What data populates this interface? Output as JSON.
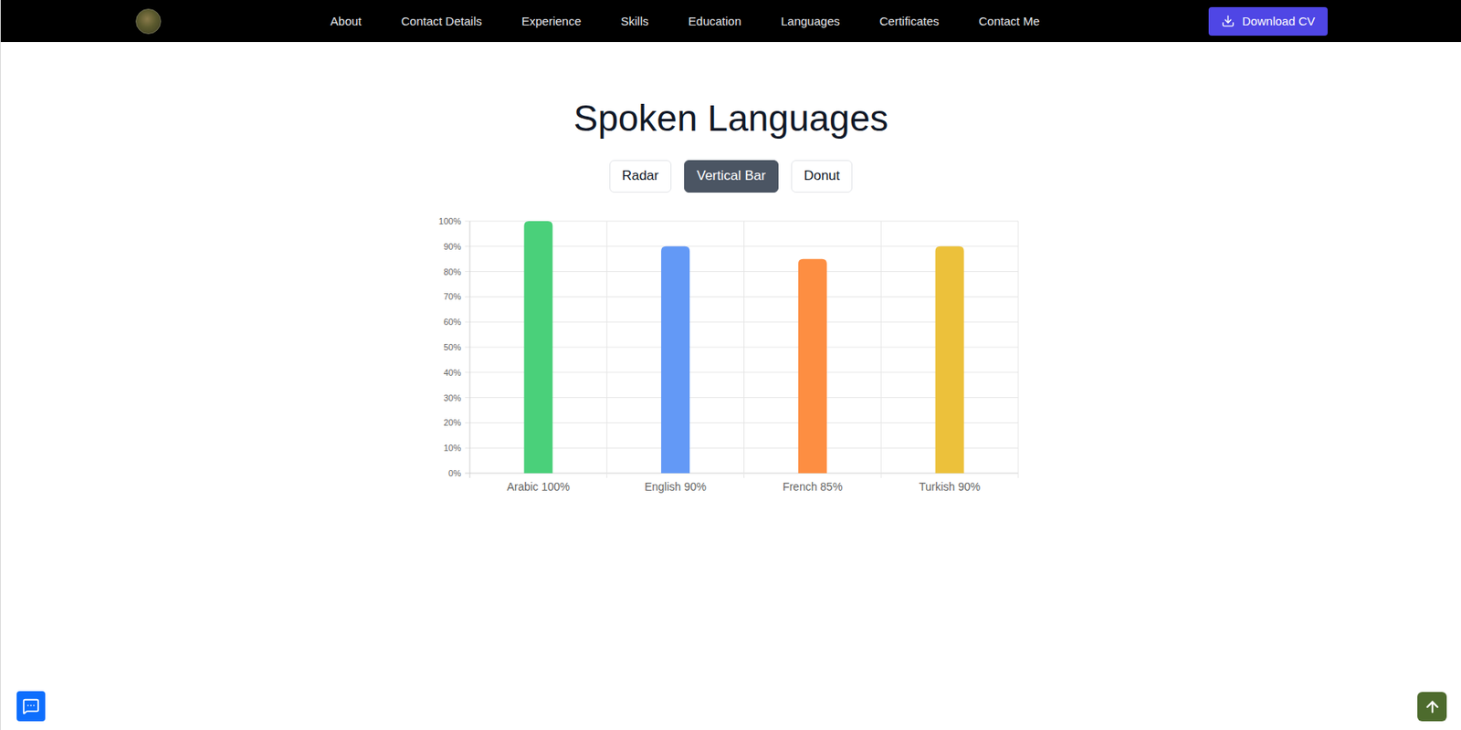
{
  "nav": {
    "items": [
      "About",
      "Contact Details",
      "Experience",
      "Skills",
      "Education",
      "Languages",
      "Certificates",
      "Contact Me"
    ],
    "download_button": "Download CV"
  },
  "section": {
    "title": "Spoken Languages"
  },
  "chart_types": [
    {
      "label": "Radar",
      "selected": false
    },
    {
      "label": "Vertical Bar",
      "selected": true
    },
    {
      "label": "Donut",
      "selected": false
    }
  ],
  "chart": {
    "y_ticks": [
      "0%",
      "10%",
      "20%",
      "30%",
      "40%",
      "50%",
      "60%",
      "70%",
      "80%",
      "90%",
      "100%"
    ],
    "bars": [
      {
        "label": "Arabic 100%",
        "value": 100,
        "color": "#4ad07a"
      },
      {
        "label": "English 90%",
        "value": 90,
        "color": "#6399f6"
      },
      {
        "label": "French 85%",
        "value": 85,
        "color": "#fd8e42"
      },
      {
        "label": "Turkish 90%",
        "value": 90,
        "color": "#ecc13b"
      }
    ]
  }
}
